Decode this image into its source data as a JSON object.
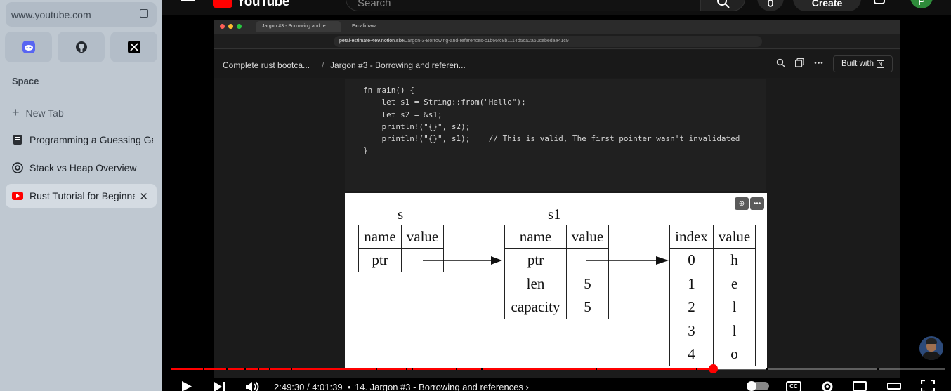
{
  "sidebar": {
    "url": "www.youtube.com",
    "favorites": [
      {
        "name": "discord-icon"
      },
      {
        "name": "github-icon"
      },
      {
        "name": "x-icon"
      }
    ],
    "space_label": "Space",
    "new_tab_label": "New Tab",
    "tabs": [
      {
        "label": "Programming a Guessing Game",
        "icon": "book-icon"
      },
      {
        "label": "Stack vs Heap Overview",
        "icon": "openai-icon"
      },
      {
        "label": "Rust Tutorial for Beginners",
        "icon": "youtube-icon",
        "active": true
      }
    ]
  },
  "youtube": {
    "logo_text": "YouTube",
    "search_placeholder": "Search",
    "create_label": "Create",
    "avatar_letter": "P"
  },
  "video": {
    "browser_tabs": [
      "Jargon #3 - Borrowing and re...",
      "Excalidraw"
    ],
    "address_host": "petal-estimate-4e9.notion.site",
    "address_path": "/Jargon-3-Borrowing-and-references-c1b66fc8b1114d5ca2a60cebedae41c9",
    "breadcrumb_1": "Complete rust bootca...",
    "breadcrumb_sep": "/",
    "breadcrumb_2": "Jargon #3 - Borrowing and referen...",
    "built_with": "Built with",
    "code_lines": [
      "fn main() {",
      "    let s1 = String::from(\"Hello\");",
      "    let s2 = &s1;",
      "",
      "    println!(\"{}\", s2);",
      "    println!(\"{}\", s1);    // This is valid, The first pointer wasn't invalidated",
      "}"
    ],
    "diagram": {
      "title_s": "s",
      "title_s1": "s1",
      "table_s": {
        "headers": [
          "name",
          "value"
        ],
        "rows": [
          [
            "ptr",
            ""
          ]
        ]
      },
      "table_s1": {
        "headers": [
          "name",
          "value"
        ],
        "rows": [
          [
            "ptr",
            ""
          ],
          [
            "len",
            "5"
          ],
          [
            "capacity",
            "5"
          ]
        ]
      },
      "table_heap": {
        "headers": [
          "index",
          "value"
        ],
        "rows": [
          [
            "0",
            "h"
          ],
          [
            "1",
            "e"
          ],
          [
            "2",
            "l"
          ],
          [
            "3",
            "l"
          ],
          [
            "4",
            "o"
          ]
        ]
      }
    }
  },
  "player": {
    "time": "2:49:30 / 4:01:39",
    "separator": "•",
    "chapter": "14. Jargon #3 - Borrowing and references",
    "chapter_arrow": "›",
    "progress_fraction": 0.7,
    "cc_label": "CC",
    "colors": {
      "progress": "#ff0000"
    }
  }
}
